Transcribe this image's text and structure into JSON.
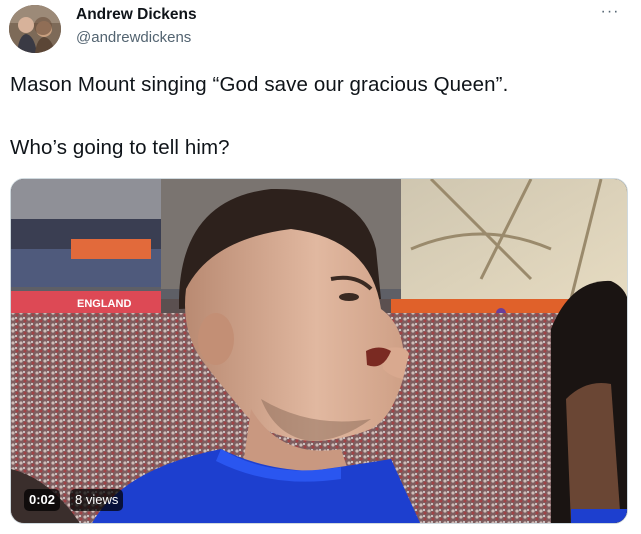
{
  "author": {
    "display_name": "Andrew Dickens",
    "handle": "@andrewdickens"
  },
  "more_icon": "more-horizontal-icon",
  "more_glyph": "···",
  "tweet": {
    "line1": "Mason Mount singing “God save our gracious Queen”.",
    "line2": "Who’s going to tell him?"
  },
  "video": {
    "duration": "0:02",
    "views": "8 views",
    "stadium_banner_text": "ENGLAND"
  },
  "colors": {
    "handle_gray": "#536471",
    "text_dark": "#0f1419",
    "jersey_blue": "#1d3fcf",
    "banner_orange": "#e0612a",
    "banner_purple": "#6a3d9a"
  }
}
